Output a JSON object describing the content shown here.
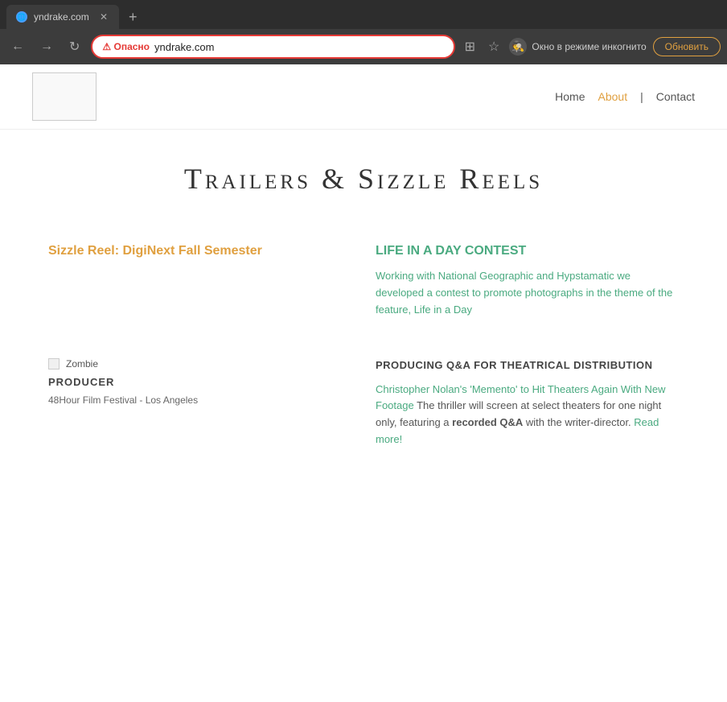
{
  "browser": {
    "tab": {
      "title": "yndrake.com",
      "favicon": "🌐"
    },
    "addressBar": {
      "warning": "⚠ Опасно",
      "url": "yndrake.com"
    },
    "incognito": {
      "label": "Окно в режиме инкогнито",
      "icon": "🕵"
    },
    "updateBtn": "Обновить",
    "navBack": "←",
    "navForward": "→",
    "navRefresh": "↻",
    "tabClose": "✕",
    "tabNew": "+"
  },
  "site": {
    "nav": {
      "home": "Home",
      "about": "About",
      "separator": "|",
      "contact": "Contact"
    },
    "pageTitle": "Trailers & Sizzle Reels",
    "cards": [
      {
        "id": "sizzle-reel",
        "title": "Sizzle Reel: DigiNext Fall Semester",
        "titleColor": "orange",
        "body": ""
      },
      {
        "id": "life-in-a-day",
        "title": "LIFE IN A DAY CONTEST",
        "titleColor": "green",
        "body": "Working with National Geographic and Hypstamatic we developed a contest to promote photographs in the theme of the feature, Life in a Day"
      },
      {
        "id": "producer",
        "sectionTitle": "PRODUCER",
        "subtitle": "48Hour Film Festival - Los Angeles",
        "imageAlt": "Zombie"
      },
      {
        "id": "producing-qa",
        "sectionTitle": "PRODUCING Q&A FOR THEATRICAL DISTRIBUTION",
        "link": "Christopher Nolan's 'Memento' to Hit Theaters Again With New Footage",
        "body1": " The thriller will screen at select theaters for one night only, featuring a ",
        "bold": "recorded Q&A",
        "body2": " with the writer-director. ",
        "readMore": "Read more!"
      }
    ]
  }
}
